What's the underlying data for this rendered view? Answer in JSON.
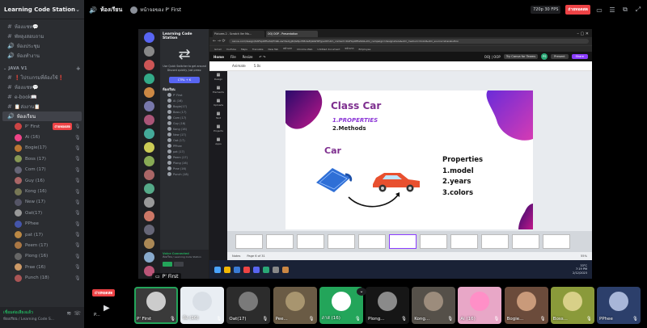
{
  "server": {
    "name": "Learning Code Station"
  },
  "channels_top": [
    {
      "label": "ห้องแชท💬"
    },
    {
      "label": "พัทลุงสอบถาม"
    },
    {
      "label": "ห้องประชุม"
    },
    {
      "label": "ห้องทำงาน"
    }
  ],
  "category": {
    "label": "JAVA V1"
  },
  "channels_java": [
    {
      "label": "❗โปรแกรมที่ต้องใช้❗"
    },
    {
      "label": "ห้องแชท💬"
    },
    {
      "label": "e-book📖"
    },
    {
      "label": "📋ส่งงาน📋"
    }
  ],
  "voice_channel": {
    "label": "ห้องเรียน"
  },
  "voice_users": [
    {
      "name": "P' First",
      "live": "ถ่ายทอดสด",
      "color": "#c44"
    },
    {
      "name": "Ai (16)",
      "color": "#e48"
    },
    {
      "name": "Bogie(17)",
      "color": "#b73"
    },
    {
      "name": "Boss (17)",
      "color": "#895"
    },
    {
      "name": "Com (17)",
      "color": "#667"
    },
    {
      "name": "Guy (16)",
      "color": "#a66"
    },
    {
      "name": "Kong (16)",
      "color": "#775"
    },
    {
      "name": "New (17)",
      "color": "#556"
    },
    {
      "name": "Oat(17)",
      "color": "#999"
    },
    {
      "name": "PPhee",
      "color": "#45a"
    },
    {
      "name": "pat (17)",
      "color": "#b84"
    },
    {
      "name": "Peem (17)",
      "color": "#a74"
    },
    {
      "name": "Plong (16)",
      "color": "#666"
    },
    {
      "name": "Prae (16)",
      "color": "#c96"
    },
    {
      "name": "Punch (18)",
      "color": "#a55"
    }
  ],
  "voice_panel": {
    "status": "เชื่อมต่อเสียงแล้ว",
    "sub": "ห้องเรียน / Learning Code S..."
  },
  "topbar": {
    "channel": "ห้องเรียน",
    "streamer": "หน้าจอของ P' First",
    "fps": "720p 30 FPS",
    "live": "ถ่ายทอดสด"
  },
  "screen": {
    "mini": {
      "server_name": "Learning Code Station",
      "tip": "Use Quick Switcher to get around Discord quickly. Just press:",
      "ctrl": "CTRL + K",
      "header": "ห้องเรียน",
      "users": [
        "P' First",
        "Ai (16)",
        "Bogie(17)",
        "Boss (17)",
        "Com (17)",
        "Guy (16)",
        "Kong (16)",
        "New (17)",
        "Oat (17)",
        "PPhee",
        "pat (17)",
        "Peem (17)",
        "Plong (16)",
        "Prae (16)",
        "Punch (18)"
      ],
      "voice_ok": "Voice Connected",
      "voice_sub": "ห้องเรียน / Learning Code Station"
    },
    "browser": {
      "tabs": [
        "Pictures 2 - Scratch Ver Ma...",
        "OOJ OOP - Presentation",
        ""
      ],
      "url": "canva.com/design/DAFbpOfEwS0/fm9b-AeY0eUyJ4QG8pcEPk4eEpWaH6Fg/edit?utm_content=DAFbpOfEwS0&utm_campaign=designshare&utm_medium=link2&utm_source=sharebutton",
      "bookmarks": [
        "Gmail",
        "YouTube",
        "Maps",
        "Translate",
        "New Tab",
        "หน้าแรก",
        "Chrome Web",
        "Untitled document",
        "หน้าแรก",
        "Employee"
      ]
    },
    "canva": {
      "home": "Home",
      "file": "File",
      "resize": "Resize",
      "doc": "OOJ | OOP",
      "try": "Try Canva for Teams",
      "avatar": "PS",
      "present": "Present",
      "share": "Share",
      "animate": "Animate",
      "duration": "5.0s",
      "rail": [
        "Design",
        "Elements",
        "Uploads",
        "Text",
        "Projects",
        "Apps"
      ],
      "notes": "Notes",
      "page": "Page 6 of 31",
      "zoom": "55%"
    },
    "slide": {
      "title": "Class Car",
      "p1": "1.PROPERTIES",
      "p2": "2.Methods",
      "car": "Car",
      "props": [
        "Properties",
        "1.model",
        "2.years",
        "3.colors"
      ]
    },
    "taskbar": {
      "weather": "33°C",
      "time": "7:19 PM",
      "date": "2/12/2023"
    },
    "presenter": "P' First"
  },
  "strip": {
    "live": "ถ่ายทอดสด",
    "self_label": "P...",
    "tiles": [
      {
        "name": "P' First",
        "bg": "#3a3a3a",
        "face": "#ccc",
        "selected": true
      },
      {
        "name": "พิง (16)",
        "bg": "#e9eef3",
        "face": "#d9dfe6"
      },
      {
        "name": "Oat(17)",
        "bg": "#2c2c2c",
        "face": "#7a7a7a"
      },
      {
        "name": "Pee...",
        "bg": "#6a5b45",
        "face": "#a8956f"
      },
      {
        "name": "ภาส (16)",
        "bg": "#23a55a",
        "face": "#ffffff"
      },
      {
        "name": "Plong...",
        "bg": "#161616",
        "face": "#8a8a8a"
      },
      {
        "name": "Kong...",
        "bg": "#555049",
        "face": "#9c8c7c"
      },
      {
        "name": "Ai (16)",
        "bg": "#e8a7c7",
        "face": "#ff8fc7"
      },
      {
        "name": "Bogie...",
        "bg": "#6b4b3b",
        "face": "#c99a7a"
      },
      {
        "name": "Boss...",
        "bg": "#8a9a3a",
        "face": "#d8d088"
      },
      {
        "name": "PPhee",
        "bg": "#2c3f6b",
        "face": "#a8b6d8"
      }
    ]
  },
  "colors": {
    "accent": "#5865f2",
    "live": "#ed4245",
    "voice": "#23a55a",
    "canva": "#8b3dff"
  }
}
